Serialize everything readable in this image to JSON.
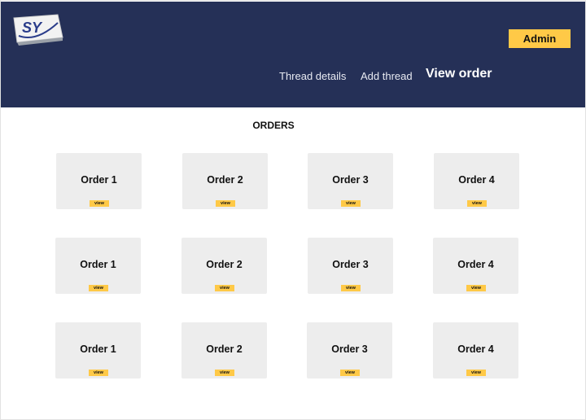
{
  "header": {
    "logo_text": "SY",
    "admin_label": "Admin",
    "nav": [
      {
        "label": "Thread details"
      },
      {
        "label": "Add thread"
      },
      {
        "label": "View order"
      }
    ]
  },
  "page_title": "ORDERS",
  "orders": [
    {
      "title": "Order 1",
      "button": "view"
    },
    {
      "title": "Order 2",
      "button": "view"
    },
    {
      "title": "Order 3",
      "button": "view"
    },
    {
      "title": "Order 4",
      "button": "view"
    },
    {
      "title": "Order 1",
      "button": "view"
    },
    {
      "title": "Order 2",
      "button": "view"
    },
    {
      "title": "Order 3",
      "button": "view"
    },
    {
      "title": "Order 4",
      "button": "view"
    },
    {
      "title": "Order 1",
      "button": "view"
    },
    {
      "title": "Order 2",
      "button": "view"
    },
    {
      "title": "Order 3",
      "button": "view"
    },
    {
      "title": "Order 4",
      "button": "view"
    }
  ],
  "colors": {
    "header": "#253057",
    "accent": "#ffc947",
    "card": "#ededed"
  }
}
